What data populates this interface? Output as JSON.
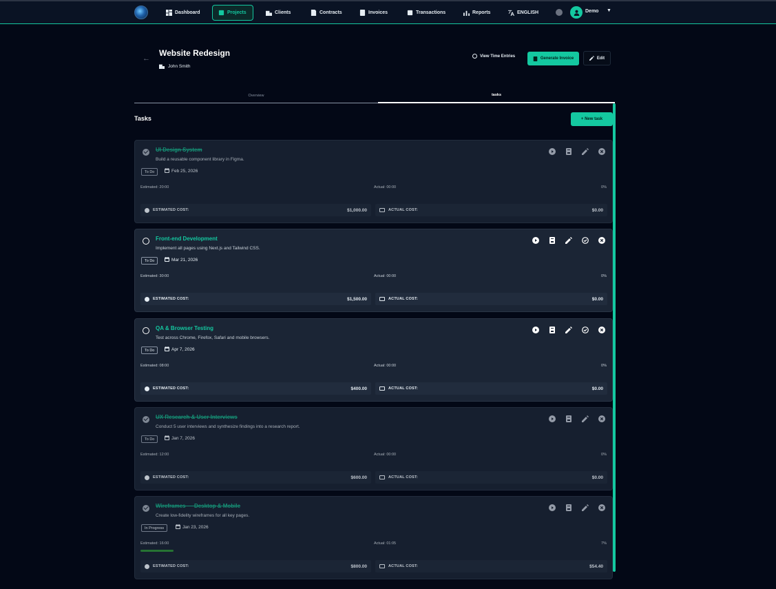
{
  "nav": {
    "items": [
      {
        "label": "Dashboard",
        "icon": "dashboard-icon"
      },
      {
        "label": "Projects",
        "icon": "projects-icon"
      },
      {
        "label": "Clients",
        "icon": "clients-icon"
      },
      {
        "label": "Contracts",
        "icon": "contracts-icon"
      },
      {
        "label": "Invoices",
        "icon": "invoices-icon"
      },
      {
        "label": "Transactions",
        "icon": "transactions-icon"
      },
      {
        "label": "Reports",
        "icon": "reports-icon"
      },
      {
        "label": "ENGLISH",
        "icon": "translate-icon"
      }
    ],
    "active": "Projects",
    "user_name": "Demo"
  },
  "project": {
    "title": "Website Redesign",
    "client": "John Smith"
  },
  "header_actions": {
    "time_entries_label": "View Time Entries",
    "generate_invoice_label": "Generate Invoice",
    "edit_label": "Edit"
  },
  "tabs": [
    {
      "label": "Overview",
      "active": false
    },
    {
      "label": "tasks",
      "active": true
    }
  ],
  "tasks_section": {
    "heading": "Tasks",
    "new_task_label": "+ New task"
  },
  "colors": {
    "accent": "#14c8a0",
    "background": "#030816",
    "card": "#1b2535",
    "progress": "#2e8b3a"
  },
  "tasks": [
    {
      "title": "UI Design System",
      "description": "Build a reusable component library in Figma.",
      "status": "To Do",
      "due": "Feb 25, 2026",
      "estimated": "Estimated: 20:00",
      "actual": "Actual: 00:00",
      "percent": "0%",
      "progress": 0,
      "estimated_cost_label": "ESTIMATED COST:",
      "estimated_cost": "$1,000.00",
      "actual_cost_label": "ACTUAL COST:",
      "actual_cost": "$0.00",
      "completed": true
    },
    {
      "title": "Front-end Development",
      "description": "Implement all pages using Next.js and Tailwind CSS.",
      "status": "To Do",
      "due": "Mar 21, 2026",
      "estimated": "Estimated: 30:00",
      "actual": "Actual: 00:00",
      "percent": "0%",
      "progress": 0,
      "estimated_cost_label": "ESTIMATED COST:",
      "estimated_cost": "$1,500.00",
      "actual_cost_label": "ACTUAL COST:",
      "actual_cost": "$0.00",
      "completed": false
    },
    {
      "title": "QA & Browser Testing",
      "description": "Test across Chrome, Firefox, Safari and mobile browsers.",
      "status": "To Do",
      "due": "Apr 7, 2026",
      "estimated": "Estimated: 08:00",
      "actual": "Actual: 00:00",
      "percent": "0%",
      "progress": 0,
      "estimated_cost_label": "ESTIMATED COST:",
      "estimated_cost": "$400.00",
      "actual_cost_label": "ACTUAL COST:",
      "actual_cost": "$0.00",
      "completed": false
    },
    {
      "title": "UX Research & User Interviews",
      "description": "Conduct 5 user interviews and synthesize findings into a research report.",
      "status": "To Do",
      "due": "Jan 7, 2026",
      "estimated": "Estimated: 12:00",
      "actual": "Actual: 00:00",
      "percent": "0%",
      "progress": 0,
      "estimated_cost_label": "ESTIMATED COST:",
      "estimated_cost": "$600.00",
      "actual_cost_label": "ACTUAL COST:",
      "actual_cost": "$0.00",
      "completed": true
    },
    {
      "title": "Wireframes — Desktop & Mobile",
      "description": "Create low-fidelity wireframes for all key pages.",
      "status": "In Progress",
      "due": "Jan 23, 2026",
      "estimated": "Estimated: 16:00",
      "actual": "Actual: 01:05",
      "percent": "7%",
      "progress": 0.07,
      "estimated_cost_label": "ESTIMATED COST:",
      "estimated_cost": "$800.00",
      "actual_cost_label": "ACTUAL COST:",
      "actual_cost": "$54.40",
      "completed": true
    }
  ]
}
